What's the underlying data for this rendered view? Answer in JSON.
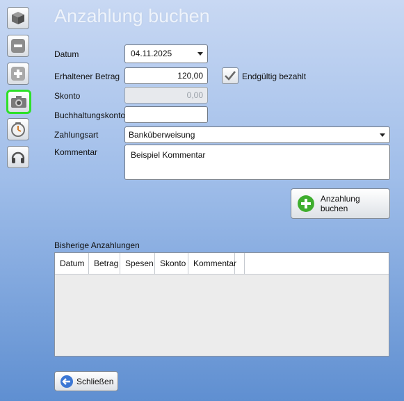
{
  "page": {
    "title": "Anzahlung buchen"
  },
  "toolbar": {
    "buttons": [
      {
        "icon": "box-icon"
      },
      {
        "icon": "minus-icon"
      },
      {
        "icon": "plus-icon"
      },
      {
        "icon": "camera-icon",
        "active": true
      },
      {
        "icon": "clock-icon"
      },
      {
        "icon": "headset-icon"
      }
    ]
  },
  "form": {
    "datum": {
      "label": "Datum",
      "value": "04.11.2025"
    },
    "betrag": {
      "label": "Erhaltener Betrag",
      "value": "120,00"
    },
    "endgueltig": {
      "label": "Endgültig bezahlt",
      "checked": true
    },
    "skonto": {
      "label": "Skonto",
      "value": "0,00"
    },
    "konto": {
      "label": "Buchhaltungskonto",
      "value": ""
    },
    "zahlungsart": {
      "label": "Zahlungsart",
      "value": "Banküberweisung"
    },
    "kommentar": {
      "label": "Kommentar",
      "value": "Beispiel Kommentar"
    },
    "submit_label": "Anzahlung buchen"
  },
  "history": {
    "label": "Bisherige Anzahlungen",
    "columns": [
      "Datum",
      "Betrag",
      "Spesen",
      "Skonto",
      "Kommentar"
    ],
    "rows": []
  },
  "footer": {
    "close_label": "Schließen"
  },
  "colors": {
    "active_highlight": "#2ee02a",
    "accent_green": "#3fae2e",
    "accent_blue": "#3b77d4"
  }
}
